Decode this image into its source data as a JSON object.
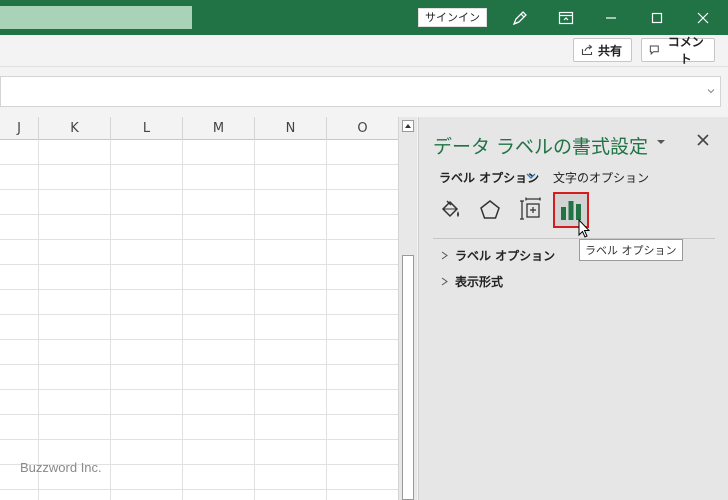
{
  "titlebar": {
    "signin_label": "サインイン",
    "icons": [
      "pen-icon",
      "ribbon-display-icon",
      "minimize-icon",
      "maximize-icon",
      "close-icon"
    ]
  },
  "ribbon": {
    "share_label": "共有",
    "comment_label": "コメント"
  },
  "grid": {
    "columns": [
      "J",
      "K",
      "L",
      "M",
      "N",
      "O"
    ]
  },
  "watermark": "Buzzword Inc.",
  "pane": {
    "title": "データ ラベルの書式設定",
    "tab_label_options": "ラベル オプション",
    "tab_text_options": "文字のオプション",
    "icons": [
      "fill-line-icon",
      "effects-pentagon-icon",
      "size-properties-icon",
      "label-options-chart-icon"
    ],
    "sections": [
      "ラベル オプション",
      "表示形式"
    ],
    "tooltip": "ラベル オプション",
    "accent_color": "#217346",
    "highlight_color": "#d41d1d"
  },
  "theme": {
    "titlebar_color": "#217346"
  }
}
